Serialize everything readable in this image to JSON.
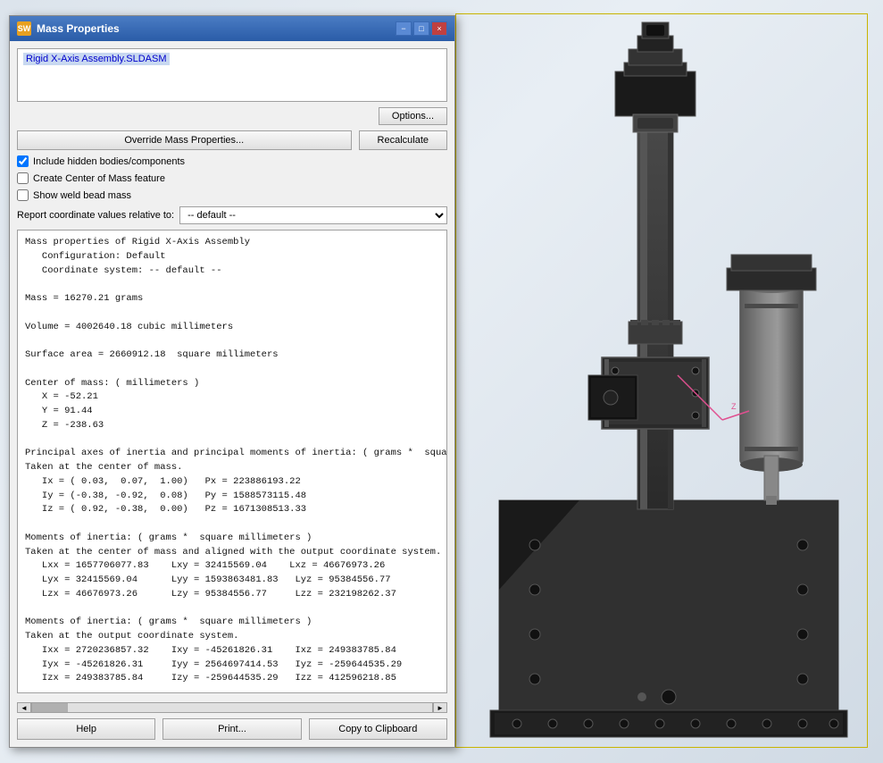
{
  "titleBar": {
    "icon": "SW",
    "title": "Mass Properties",
    "minimizeLabel": "−",
    "maximizeLabel": "□",
    "closeLabel": "×"
  },
  "assemblyName": "Rigid X-Axis Assembly.SLDASM",
  "optionsButton": "Options...",
  "overrideButton": "Override Mass Properties...",
  "recalculateButton": "Recalculate",
  "checkboxes": {
    "includeHidden": {
      "label": "Include hidden bodies/components",
      "checked": true
    },
    "createCenter": {
      "label": "Create Center of Mass feature",
      "checked": false
    },
    "showWeld": {
      "label": "Show weld bead mass",
      "checked": false
    }
  },
  "coordinateDropdown": {
    "label": "Report coordinate values relative to:",
    "value": "-- default --",
    "options": [
      "-- default --"
    ]
  },
  "massDataLines": [
    "Mass properties of Rigid X-Axis Assembly",
    "   Configuration: Default",
    "   Coordinate system: -- default --",
    "",
    "Mass = 16270.21 grams",
    "",
    "Volume = 4002640.18 cubic millimeters",
    "",
    "Surface area = 2660912.18  square millimeters",
    "",
    "Center of mass: ( millimeters )",
    "   X = -52.21",
    "   Y = 91.44",
    "   Z = -238.63",
    "",
    "Principal axes of inertia and principal moments of inertia: ( grams *  square mi",
    "Taken at the center of mass.",
    "   Ix = ( 0.03,  0.07,  1.00)   Px = 223886193.22",
    "   Iy = (-0.38, -0.92,  0.08)   Py = 1588573115.48",
    "   Iz = ( 0.92, -0.38,  0.00)   Pz = 1671308513.33",
    "",
    "Moments of inertia: ( grams *  square millimeters )",
    "Taken at the center of mass and aligned with the output coordinate system.",
    "   Lxx = 1657706077.83    Lxy = 32415569.04    Lxz = 46676973.26",
    "   Lyx = 32415569.04      Lyy = 1593863481.83   Lyz = 95384556.77",
    "   Lzx = 46676973.26      Lzy = 95384556.77     Lzz = 232198262.37",
    "",
    "Moments of inertia: ( grams *  square millimeters )",
    "Taken at the output coordinate system.",
    "   Ixx = 2720236857.32    Ixy = -45261826.31    Ixz = 249383785.84",
    "   Iyx = -45261826.31     Iyy = 2564697414.53   Iyz = -259644535.29",
    "   Izx = 249383785.84     Izy = -259644535.29   Izz = 412596218.85"
  ],
  "bottomButtons": {
    "help": "Help",
    "print": "Print...",
    "copyToClipboard": "Copy to Clipboard"
  }
}
